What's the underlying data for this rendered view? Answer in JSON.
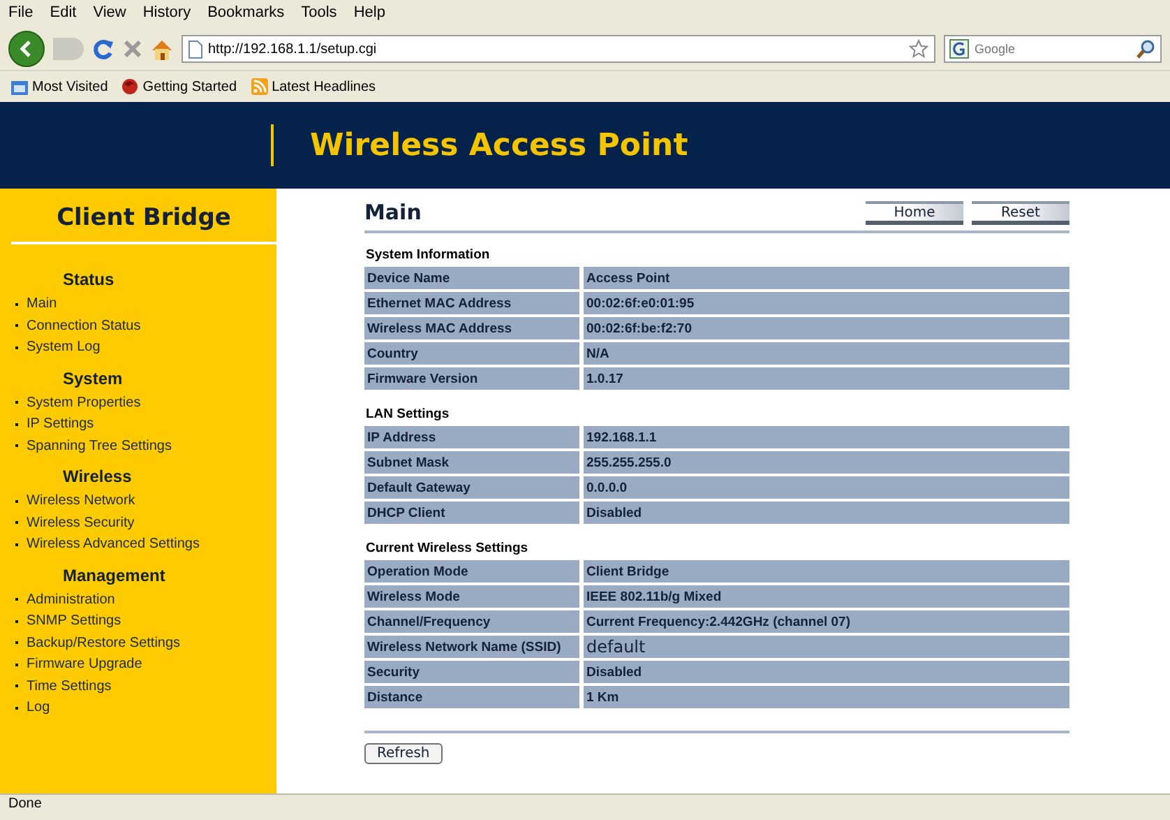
{
  "menu_bar": [
    "File",
    "Edit",
    "View",
    "History",
    "Bookmarks",
    "Tools",
    "Help"
  ],
  "nav_bar": {
    "url": "http://192.168.1.1/setup.cgi",
    "search_placeholder": "Google"
  },
  "bookmarks": [
    {
      "label": "Most Visited",
      "kind": "folder"
    },
    {
      "label": "Getting Started",
      "kind": "ball"
    },
    {
      "label": "Latest Headlines",
      "kind": "feed"
    }
  ],
  "header": {
    "title": "Wireless Access Point"
  },
  "sidebar": {
    "title": "Client Bridge",
    "groups": [
      {
        "heading": "Status",
        "items": [
          "Main",
          "Connection Status",
          "System Log"
        ]
      },
      {
        "heading": "System",
        "items": [
          "System Properties",
          "IP Settings",
          "Spanning Tree Settings"
        ]
      },
      {
        "heading": "Wireless",
        "items": [
          "Wireless Network",
          "Wireless Security",
          "Wireless Advanced Settings"
        ]
      },
      {
        "heading": "Management",
        "items": [
          "Administration",
          "SNMP Settings",
          "Backup/Restore Settings",
          "Firmware Upgrade",
          "Time Settings",
          "Log"
        ]
      }
    ]
  },
  "main": {
    "title": "Main",
    "buttons": [
      "Home",
      "Reset"
    ],
    "sections": [
      {
        "title": "System Information",
        "rows": [
          {
            "label": "Device Name",
            "value": "Access Point",
            "kind": "bold"
          },
          {
            "label": "Ethernet MAC Address",
            "value": "00:02:6f:e0:01:95",
            "kind": "bold"
          },
          {
            "label": "Wireless MAC Address",
            "value": "00:02:6f:be:f2:70",
            "kind": "bold"
          },
          {
            "label": "Country",
            "value": "N/A",
            "kind": "bold"
          },
          {
            "label": "Firmware Version",
            "value": "1.0.17",
            "kind": "bold"
          }
        ]
      },
      {
        "title": "LAN Settings",
        "rows": [
          {
            "label": "IP Address",
            "value": "192.168.1.1",
            "kind": "bold"
          },
          {
            "label": "Subnet Mask",
            "value": "255.255.255.0",
            "kind": "bold"
          },
          {
            "label": "Default Gateway",
            "value": "0.0.0.0",
            "kind": "bold"
          },
          {
            "label": "DHCP Client",
            "value": "Disabled",
            "kind": "bold"
          }
        ]
      },
      {
        "title": "Current Wireless Settings",
        "rows": [
          {
            "label": "Operation Mode",
            "value": "Client Bridge",
            "kind": "bold"
          },
          {
            "label": "Wireless Mode",
            "value": "IEEE 802.11b/g Mixed",
            "kind": "bold"
          },
          {
            "label": "Channel/Frequency",
            "value": "Current Frequency:2.442GHz (channel 07)",
            "kind": "bold"
          },
          {
            "label": "Wireless Network Name (SSID)",
            "value": "default",
            "kind": "plain"
          },
          {
            "label": "Security",
            "value": "Disabled",
            "kind": "bold"
          },
          {
            "label": "Distance",
            "value": "1 Km",
            "kind": "bold"
          }
        ]
      }
    ],
    "refresh_button": "Refresh"
  },
  "status_bar": "Done"
}
